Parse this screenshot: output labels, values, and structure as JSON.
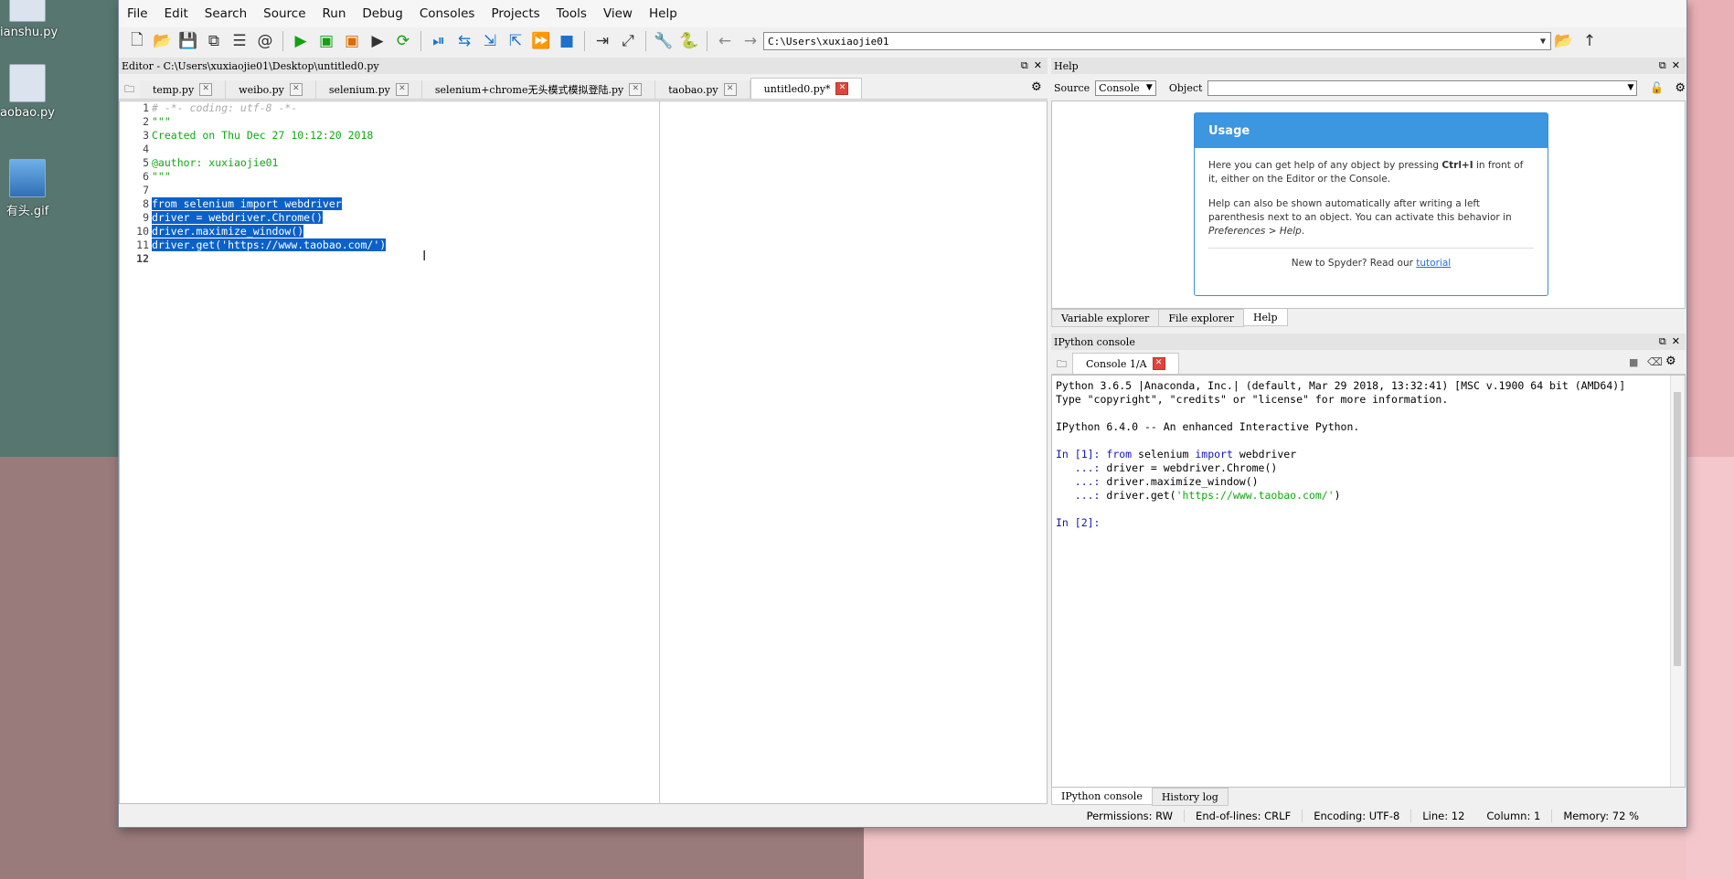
{
  "desktop": {
    "icons": [
      {
        "label": "ianshu.py",
        "kind": "file"
      },
      {
        "label": "aobao.py",
        "kind": "file"
      },
      {
        "label": "有头.gif",
        "kind": "gif"
      }
    ]
  },
  "menubar": [
    "File",
    "Edit",
    "Search",
    "Source",
    "Run",
    "Debug",
    "Consoles",
    "Projects",
    "Tools",
    "View",
    "Help"
  ],
  "toolbar": {
    "icons": [
      "new-file-icon",
      "open-file-icon",
      "save-icon",
      "save-all-icon",
      "list-icon",
      "at-icon",
      "run-icon",
      "run-cell-icon",
      "run-cell-advance-icon",
      "run-selection-icon",
      "rerun-icon",
      "debug-icon",
      "step-icon",
      "step-into-icon",
      "step-return-icon",
      "continue-icon",
      "stop-icon",
      "maximize-pane-icon",
      "fullscreen-icon",
      "preferences-icon",
      "python-icon",
      "back-arrow-icon",
      "forward-arrow-icon"
    ],
    "path": "C:\\Users\\xuxiaojie01"
  },
  "editor": {
    "title": "Editor - C:\\Users\\xuxiaojie01\\Desktop\\untitled0.py",
    "tabs": [
      {
        "label": "temp.py",
        "active": false
      },
      {
        "label": "weibo.py",
        "active": false
      },
      {
        "label": "selenium.py",
        "active": false
      },
      {
        "label": "selenium+chrome无头模式模拟登陆.py",
        "active": false
      },
      {
        "label": "taobao.py",
        "active": false
      },
      {
        "label": "untitled0.py*",
        "active": true
      }
    ],
    "lines": [
      {
        "n": "1",
        "text": "# -*- coding: utf-8 -*-",
        "style": "cm"
      },
      {
        "n": "2",
        "text": "\"\"\"",
        "style": "st"
      },
      {
        "n": "3",
        "text": "Created on Thu Dec 27 10:12:20 2018",
        "style": "st"
      },
      {
        "n": "4",
        "text": "",
        "style": "st"
      },
      {
        "n": "5",
        "text": "@author: xuxiaojie01",
        "style": "st"
      },
      {
        "n": "6",
        "text": "\"\"\"",
        "style": "st"
      },
      {
        "n": "7",
        "text": "",
        "style": ""
      },
      {
        "n": "8",
        "text": "from selenium import webdriver",
        "style": "sel"
      },
      {
        "n": "9",
        "text": "driver = webdriver.Chrome()",
        "style": "sel"
      },
      {
        "n": "10",
        "text": "driver.maximize_window()",
        "style": "sel"
      },
      {
        "n": "11",
        "text": "driver.get('https://www.taobao.com/')",
        "style": "sel"
      },
      {
        "n": "12",
        "text": "",
        "style": ""
      }
    ]
  },
  "help": {
    "title": "Help",
    "source_label": "Source",
    "source_value": "Console",
    "object_label": "Object",
    "object_value": "",
    "usage_title": "Usage",
    "usage_p1a": "Here you can get help of any object by pressing ",
    "usage_p1b": "Ctrl+I",
    "usage_p1c": " in front of it, either on the Editor or the Console.",
    "usage_p2a": "Help can also be shown automatically after writing a left parenthesis next to an object. You can activate this behavior in ",
    "usage_p2b": "Preferences > Help",
    "usage_p2c": ".",
    "foot_text": "New to Spyder? Read our ",
    "foot_link": "tutorial",
    "bottom_tabs": [
      "Variable explorer",
      "File explorer",
      "Help"
    ]
  },
  "console": {
    "title": "IPython console",
    "tab": "Console 1/A",
    "lines": [
      {
        "segs": [
          {
            "t": "Python 3.6.5 |Anaconda, Inc.| (default, Mar 29 2018, 13:32:41) [MSC v.1900 64 bit (AMD64)]",
            "c": ""
          }
        ]
      },
      {
        "segs": [
          {
            "t": "Type \"copyright\", \"credits\" or \"license\" for more information.",
            "c": ""
          }
        ]
      },
      {
        "segs": [
          {
            "t": "",
            "c": ""
          }
        ]
      },
      {
        "segs": [
          {
            "t": "IPython 6.4.0 -- An enhanced Interactive Python.",
            "c": ""
          }
        ]
      },
      {
        "segs": [
          {
            "t": "",
            "c": ""
          }
        ]
      },
      {
        "segs": [
          {
            "t": "In [1]: ",
            "c": "p"
          },
          {
            "t": "from",
            "c": "kw"
          },
          {
            "t": " selenium ",
            "c": ""
          },
          {
            "t": "import",
            "c": "kw"
          },
          {
            "t": " webdriver",
            "c": ""
          }
        ]
      },
      {
        "segs": [
          {
            "t": "   ...: ",
            "c": "p"
          },
          {
            "t": "driver = webdriver.Chrome()",
            "c": ""
          }
        ]
      },
      {
        "segs": [
          {
            "t": "   ...: ",
            "c": "p"
          },
          {
            "t": "driver.maximize_window()",
            "c": ""
          }
        ]
      },
      {
        "segs": [
          {
            "t": "   ...: ",
            "c": "p"
          },
          {
            "t": "driver.get(",
            "c": ""
          },
          {
            "t": "'https://www.taobao.com/'",
            "c": "gs"
          },
          {
            "t": ")",
            "c": ""
          }
        ]
      },
      {
        "segs": [
          {
            "t": "",
            "c": ""
          }
        ]
      },
      {
        "segs": [
          {
            "t": "In [2]: ",
            "c": "p"
          }
        ]
      }
    ],
    "bottom_tabs": [
      "IPython console",
      "History log"
    ]
  },
  "status": {
    "permissions_label": "Permissions:",
    "permissions": "RW",
    "eol_label": "End-of-lines:",
    "eol": "CRLF",
    "encoding_label": "Encoding:",
    "encoding": "UTF-8",
    "line_label": "Line:",
    "line": "12",
    "column_label": "Column:",
    "column": "1",
    "memory_label": "Memory:",
    "memory": "72 %"
  }
}
